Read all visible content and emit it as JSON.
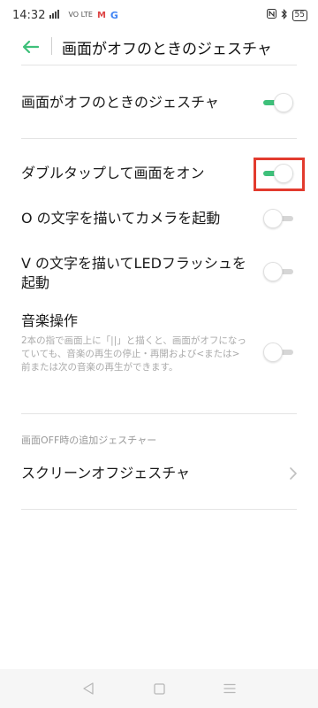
{
  "status_bar": {
    "time": "14:32",
    "signal_text": "↑",
    "volte": "VO LTE",
    "mail_glyph": "M",
    "g_glyph": "G",
    "nfc_text": "N",
    "bluetooth_text": "✲",
    "battery": "55"
  },
  "header": {
    "title": "画面がオフのときのジェスチャ"
  },
  "settings": [
    {
      "label": "画面がオフのときのジェスチャ",
      "state": "on"
    },
    {
      "label": "ダブルタップして画面をオン",
      "state": "on"
    },
    {
      "label": "O の文字を描いてカメラを起動",
      "state": "off"
    },
    {
      "label_line1": "V の文字を描いてLEDフラッシュを",
      "label_line2": "起動",
      "state": "off"
    },
    {
      "label": "音楽操作",
      "description": "2本の指で画面上に「||」と描くと、画面がオフになっていても、音楽の再生の停止・再開および<または>前または次の音楽の再生ができます。",
      "state": "off"
    }
  ],
  "section": {
    "header": "画面OFF時の追加ジェスチャー",
    "nav_item": "スクリーンオフジェスチャ",
    "chevron": "›"
  },
  "colors": {
    "accent": "#3ec07a",
    "highlight": "#e23b2e"
  }
}
